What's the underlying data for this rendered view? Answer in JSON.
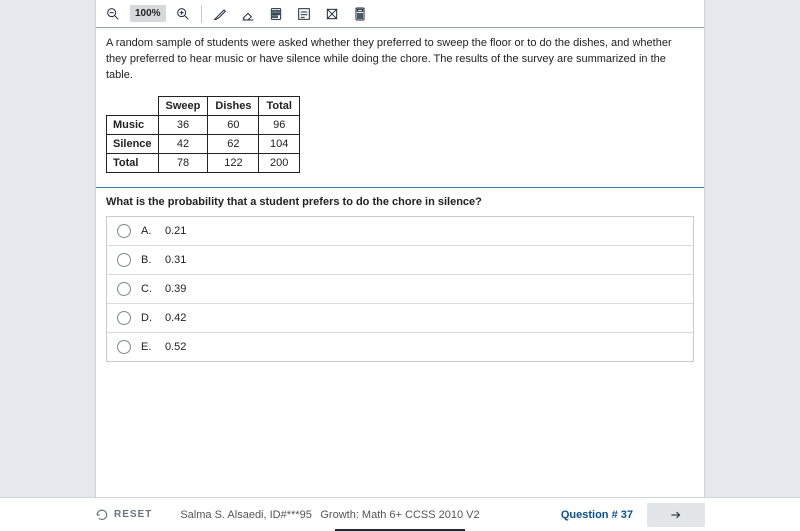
{
  "toolbar": {
    "zoom": "100%"
  },
  "prompt": "A random sample of students were asked whether they preferred to sweep the floor or to do the dishes, and whether they preferred to hear music or have silence while doing the chore. The results of the survey are summarized in the table.",
  "table": {
    "cols": [
      "Sweep",
      "Dishes",
      "Total"
    ],
    "rows": [
      {
        "label": "Music",
        "cells": [
          "36",
          "60",
          "96"
        ]
      },
      {
        "label": "Silence",
        "cells": [
          "42",
          "62",
          "104"
        ]
      },
      {
        "label": "Total",
        "cells": [
          "78",
          "122",
          "200"
        ]
      }
    ]
  },
  "question": "What is the probability that a student prefers to do the chore in silence?",
  "options": [
    {
      "letter": "A.",
      "value": "0.21"
    },
    {
      "letter": "B.",
      "value": "0.31"
    },
    {
      "letter": "C.",
      "value": "0.39"
    },
    {
      "letter": "D.",
      "value": "0.42"
    },
    {
      "letter": "E.",
      "value": "0.52"
    }
  ],
  "footer": {
    "reset": "RESET",
    "student": "Salma S. Alsaedi, ID#***95",
    "test": "Growth: Math 6+ CCSS 2010 V2",
    "qnum": "Question # 37"
  }
}
